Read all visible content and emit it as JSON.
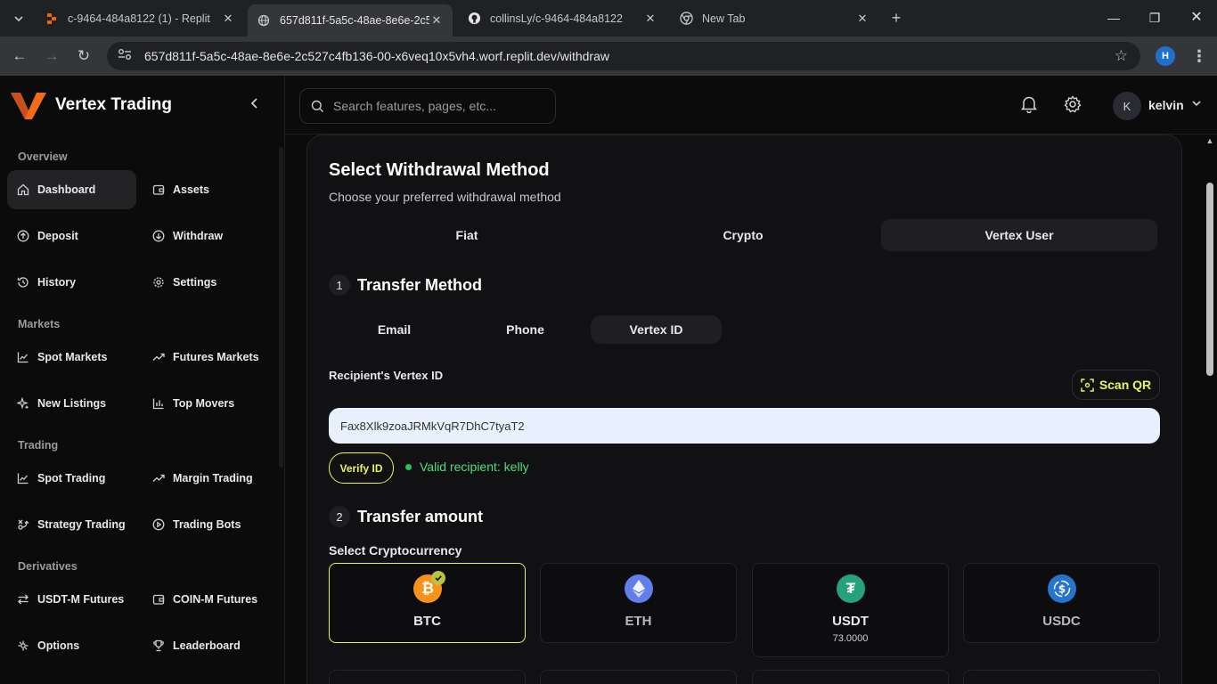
{
  "browser": {
    "tabs": [
      {
        "title": "c-9464-484a8122 (1) - Replit",
        "icon": "replit-icon"
      },
      {
        "title": "657d811f-5a5c-48ae-8e6e-2c5…",
        "icon": "globe-icon"
      },
      {
        "title": "collinsLy/c-9464-484a8122",
        "icon": "github-icon"
      },
      {
        "title": "New Tab",
        "icon": "chrome-icon"
      }
    ],
    "url": "657d811f-5a5c-48ae-8e6e-2c527c4fb136-00-x6veq10x5vh4.worf.replit.dev/withdraw",
    "profile_initial": "H"
  },
  "app": {
    "brand": "Vertex Trading",
    "search_placeholder": "Search features, pages, etc...",
    "user": {
      "initial": "K",
      "name": "kelvin"
    },
    "sidebar": {
      "sections": [
        "Overview",
        "Markets",
        "Trading",
        "Derivatives"
      ],
      "items": [
        {
          "label": "Dashboard",
          "icon": "home-icon"
        },
        {
          "label": "Assets",
          "icon": "wallet-icon"
        },
        {
          "label": "Deposit",
          "icon": "arrow-up-circle-icon"
        },
        {
          "label": "Withdraw",
          "icon": "arrow-down-circle-icon"
        },
        {
          "label": "History",
          "icon": "history-icon"
        },
        {
          "label": "Settings",
          "icon": "gear-icon"
        },
        {
          "label": "Spot Markets",
          "icon": "line-chart-icon"
        },
        {
          "label": "Futures Markets",
          "icon": "trending-up-icon"
        },
        {
          "label": "New Listings",
          "icon": "sparkles-icon"
        },
        {
          "label": "Top Movers",
          "icon": "bar-chart-icon"
        },
        {
          "label": "Spot Trading",
          "icon": "line-chart-icon"
        },
        {
          "label": "Margin Trading",
          "icon": "trending-up-icon"
        },
        {
          "label": "Strategy Trading",
          "icon": "strategy-icon"
        },
        {
          "label": "Trading Bots",
          "icon": "play-circle-icon"
        },
        {
          "label": "USDT-M Futures",
          "icon": "swap-icon"
        },
        {
          "label": "COIN-M Futures",
          "icon": "wallet-icon"
        },
        {
          "label": "Options",
          "icon": "options-icon"
        },
        {
          "label": "Leaderboard",
          "icon": "trophy-icon"
        }
      ]
    },
    "withdraw": {
      "title": "Select Withdrawal Method",
      "subtitle": "Choose your preferred withdrawal method",
      "method_tabs": [
        "Fiat",
        "Crypto",
        "Vertex User"
      ],
      "active_method": "Vertex User",
      "step1": {
        "num": "1",
        "label": "Transfer Method"
      },
      "transfer_tabs": [
        "Email",
        "Phone",
        "Vertex ID"
      ],
      "active_transfer": "Vertex ID",
      "recipient_label": "Recipient's Vertex ID",
      "scan_qr": "Scan QR",
      "vertex_id_value": "Fax8Xlk9zoaJRMkVqR7DhC7tyaT2",
      "verify_label": "Verify ID",
      "valid_text": "Valid recipient: kelly",
      "step2": {
        "num": "2",
        "label": "Transfer amount"
      },
      "select_crypto_label": "Select Cryptocurrency",
      "coins": [
        {
          "symbol": "BTC",
          "balance": "",
          "color": "#f7931a",
          "selected": true
        },
        {
          "symbol": "ETH",
          "balance": "",
          "color": "#627eea",
          "selected": false
        },
        {
          "symbol": "USDT",
          "balance": "73.0000",
          "color": "#26a17b",
          "selected": false
        },
        {
          "symbol": "USDC",
          "balance": "",
          "color": "#2775ca",
          "selected": false
        }
      ]
    }
  },
  "colors": {
    "accent": "#e9f35c",
    "success": "#4ade80",
    "brand_orange": "#f26b1d"
  }
}
